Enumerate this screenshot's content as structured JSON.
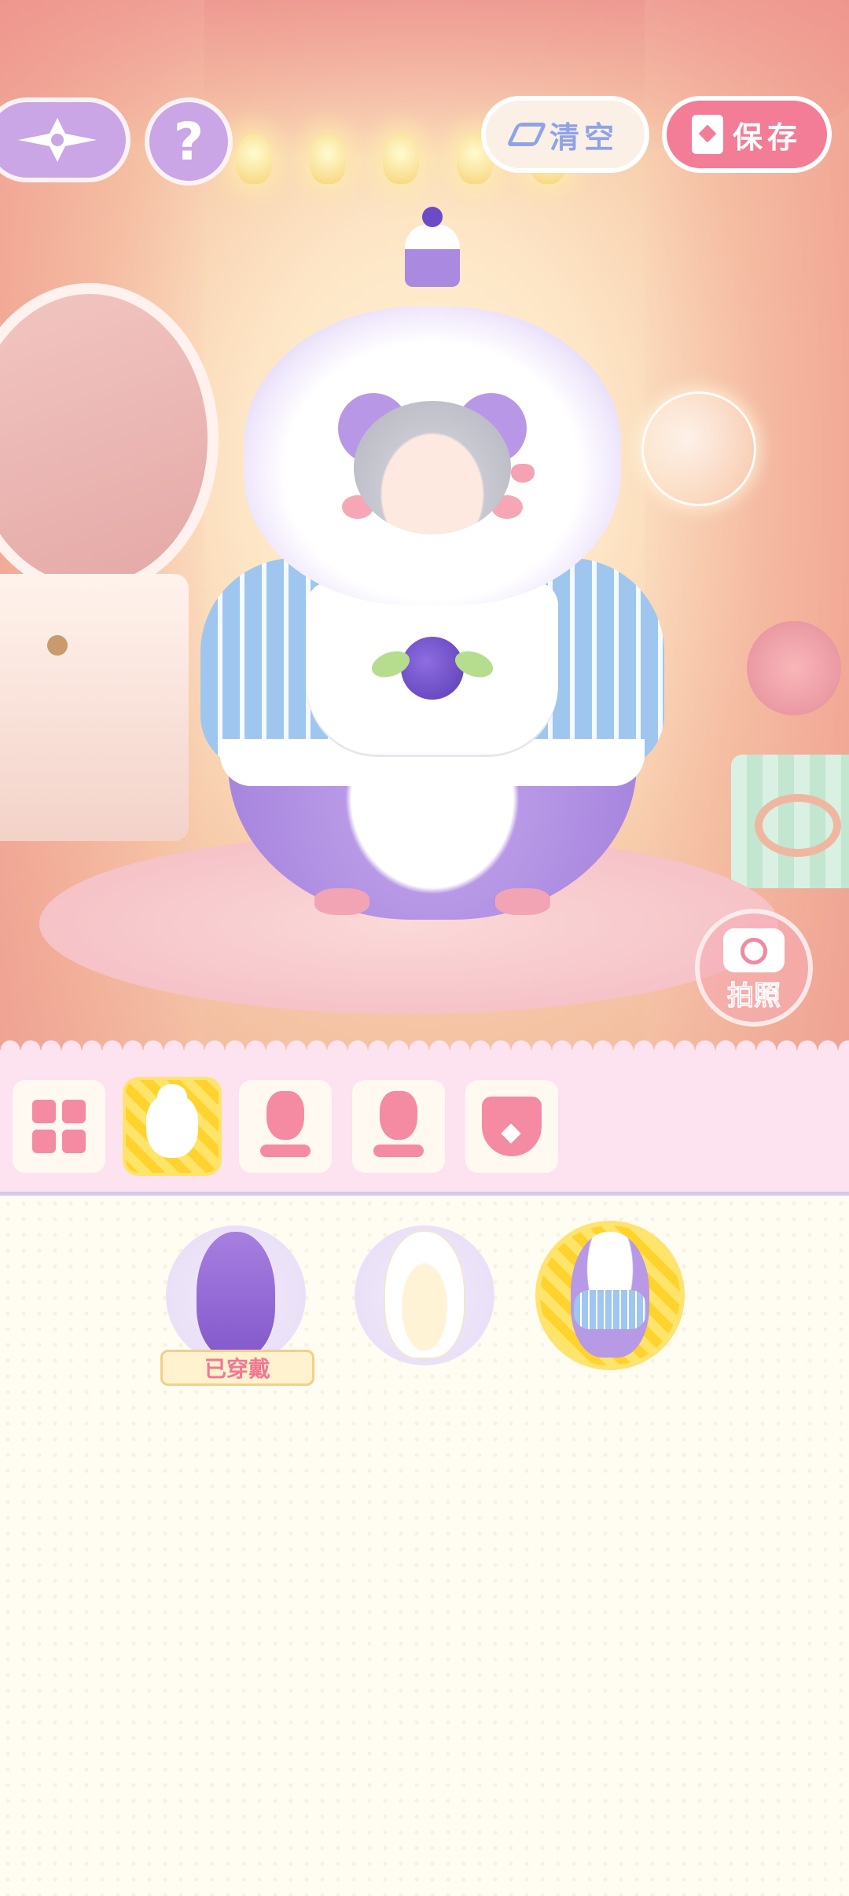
{
  "toolbar": {
    "clear_label": "清空",
    "save_label": "保存",
    "help_glyph": "?"
  },
  "camera": {
    "label": "拍照"
  },
  "category_tabs": [
    {
      "icon": "grid-icon",
      "active": false
    },
    {
      "icon": "full-body-suit-icon",
      "active": true
    },
    {
      "icon": "dress-icon",
      "active": false
    },
    {
      "icon": "outfit-stand-icon",
      "active": false
    },
    {
      "icon": "necklace-icon",
      "active": false
    }
  ],
  "items": [
    {
      "icon": "purple-hooded-cloak",
      "badge": "已穿戴",
      "selected": false
    },
    {
      "icon": "white-cat-suit",
      "badge": "",
      "selected": false
    },
    {
      "icon": "purple-hamster-suit",
      "badge": "",
      "selected": true
    }
  ],
  "colors": {
    "accent_pink": "#f37c96",
    "accent_purple": "#caa6e6",
    "clear_blue": "#8fa3e6",
    "selected_yellow": "#ffd32e",
    "tab_bar_bg": "#fde2ef",
    "panel_bg": "#fffcf1"
  }
}
